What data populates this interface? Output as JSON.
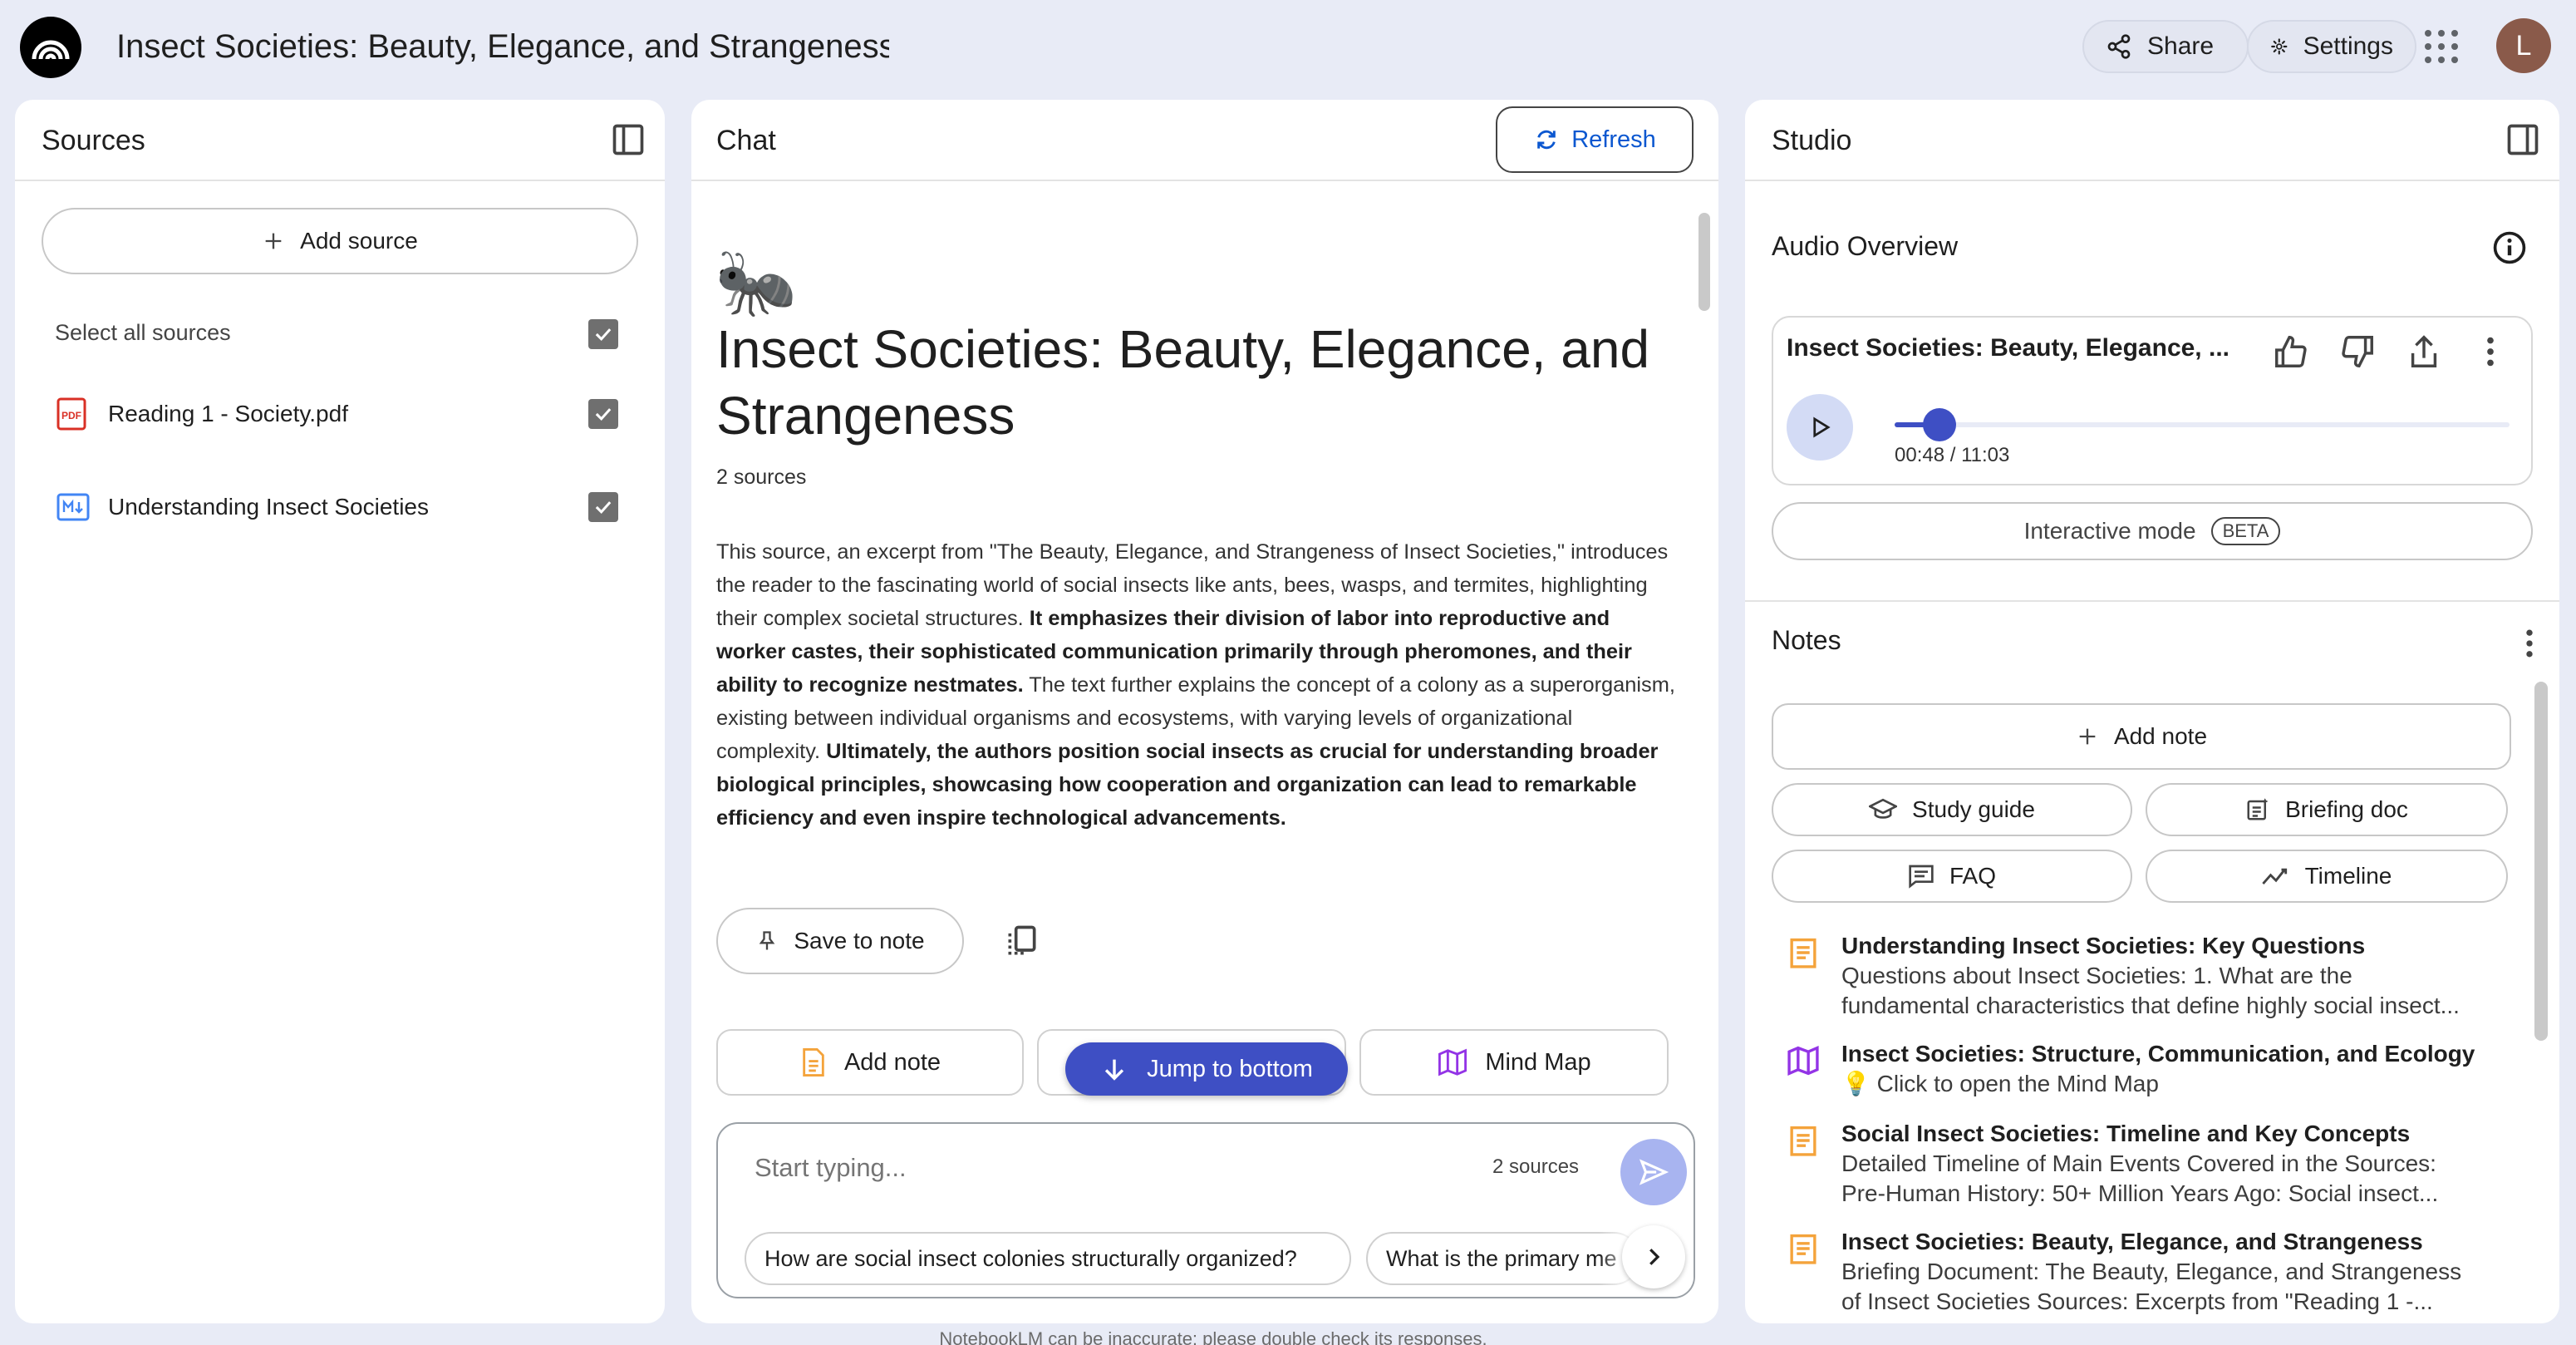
{
  "app": {
    "notebook_title": "Insect Societies: Beauty, Elegance, and Strangeness",
    "share_label": "Share",
    "settings_label": "Settings",
    "avatar_initial": "L"
  },
  "sources": {
    "title": "Sources",
    "add_source_label": "Add source",
    "select_all_label": "Select all sources",
    "items": [
      {
        "label": "Reading 1 - Society.pdf",
        "icon": "pdf-icon",
        "checked": true
      },
      {
        "label": "Understanding Insect Societies",
        "icon": "markdown-icon",
        "checked": true
      }
    ]
  },
  "chat": {
    "title": "Chat",
    "refresh_label": "Refresh",
    "emoji": "🐜",
    "heading": "Insect Societies: Beauty, Elegance, and Strangeness",
    "source_count": "2 sources",
    "summary": {
      "p1": "This source, an excerpt from \"The Beauty, Elegance, and Strangeness of Insect Societies,\" introduces the reader to the fascinating world of social insects like ants, bees, wasps, and termites, highlighting their complex societal structures. ",
      "b1": "It emphasizes their division of labor into reproductive and worker castes, their sophisticated communication primarily through pheromones, and their ability to recognize nestmates.",
      "p2": " The text further explains the concept of a colony as a superorganism, existing between individual organisms and ecosystems, with varying levels of organizational complexity. ",
      "b2": "Ultimately, the authors position social insects as crucial for understanding broader biological principles, showcasing how cooperation and organization can lead to remarkable efficiency and even inspire technological advancements."
    },
    "save_to_note_label": "Save to note",
    "add_note_label": "Add note",
    "mind_map_label": "Mind Map",
    "jump_label": "Jump to bottom",
    "input_placeholder": "Start typing...",
    "input_source_count": "2 sources",
    "suggestions": [
      "How are social insect colonies structurally organized?",
      "What is the primary me"
    ],
    "disclaimer": "NotebookLM can be inaccurate; please double check its responses."
  },
  "studio": {
    "title": "Studio",
    "audio_overview_title": "Audio Overview",
    "audio": {
      "title": "Insect Societies: Beauty, Elegance, ...",
      "time": "00:48 / 11:03",
      "progress": 0.073
    },
    "interactive_label": "Interactive mode",
    "beta_label": "BETA",
    "notes_title": "Notes",
    "add_note_label": "Add note",
    "study_guide_label": "Study guide",
    "briefing_doc_label": "Briefing doc",
    "faq_label": "FAQ",
    "timeline_label": "Timeline",
    "notes": [
      {
        "icon": "note-icon",
        "title": "Understanding Insect Societies: Key Questions",
        "lines": [
          "Questions about Insect Societies: 1. What are the",
          "fundamental characteristics that define highly social insect..."
        ]
      },
      {
        "icon": "mind-map-icon",
        "title": "Insect Societies: Structure, Communication, and Ecology",
        "lines": [
          "💡 Click to open the Mind Map"
        ]
      },
      {
        "icon": "note-icon",
        "title": "Social Insect Societies: Timeline and Key Concepts",
        "lines": [
          "Detailed Timeline of Main Events Covered in the Sources:",
          "Pre-Human History: 50+ Million Years Ago: Social insect..."
        ]
      },
      {
        "icon": "note-icon",
        "title": "Insect Societies: Beauty, Elegance, and Strangeness",
        "lines": [
          "Briefing Document: The Beauty, Elegance, and Strangeness",
          "of Insect Societies Sources: Excerpts from \"Reading 1 -..."
        ]
      }
    ],
    "colors": {
      "accent": "#3e4fc4",
      "note": "#f4a33b",
      "mind_map": "#9334e6"
    }
  }
}
